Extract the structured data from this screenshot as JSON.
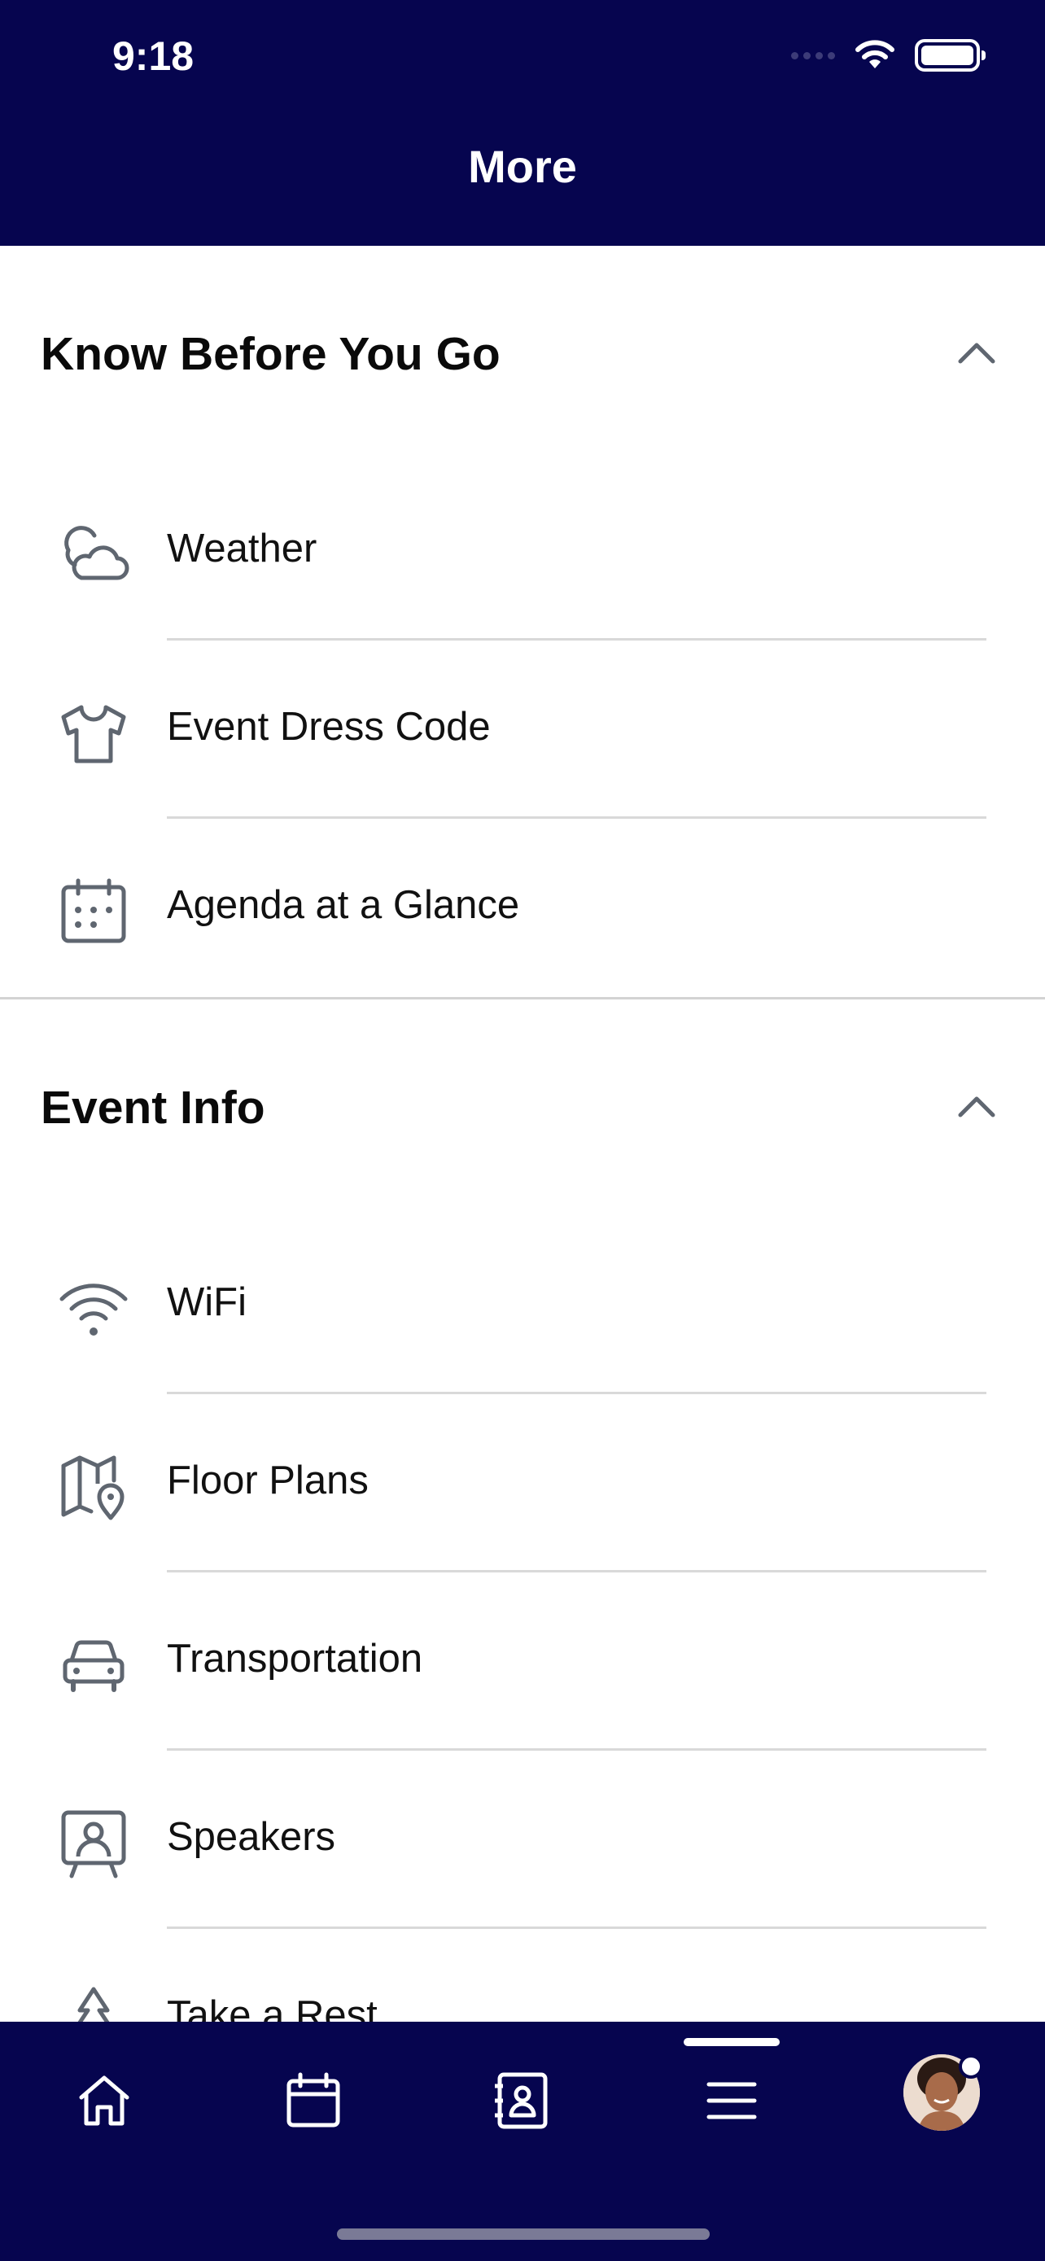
{
  "status_bar": {
    "time": "9:18"
  },
  "header": {
    "title": "More"
  },
  "sections": [
    {
      "title": "Know Before You Go",
      "items": [
        {
          "label": "Weather",
          "icon": "cloud-icon"
        },
        {
          "label": "Event Dress Code",
          "icon": "shirt-icon"
        },
        {
          "label": "Agenda at a Glance",
          "icon": "calendar-icon"
        }
      ]
    },
    {
      "title": "Event Info",
      "items": [
        {
          "label": "WiFi",
          "icon": "wifi-icon"
        },
        {
          "label": "Floor Plans",
          "icon": "map-pin-icon"
        },
        {
          "label": "Transportation",
          "icon": "car-icon"
        },
        {
          "label": "Speakers",
          "icon": "presenter-icon"
        },
        {
          "label": "Take a Rest",
          "icon": "tree-icon"
        }
      ]
    }
  ],
  "tabbar": {
    "tabs": [
      {
        "icon": "home-icon"
      },
      {
        "icon": "calendar-icon"
      },
      {
        "icon": "contact-book-icon"
      },
      {
        "icon": "menu-icon",
        "selected": true
      },
      {
        "icon": "avatar"
      }
    ]
  },
  "colors": {
    "header_bg": "#06054f",
    "icon_gray": "#5f6670"
  }
}
